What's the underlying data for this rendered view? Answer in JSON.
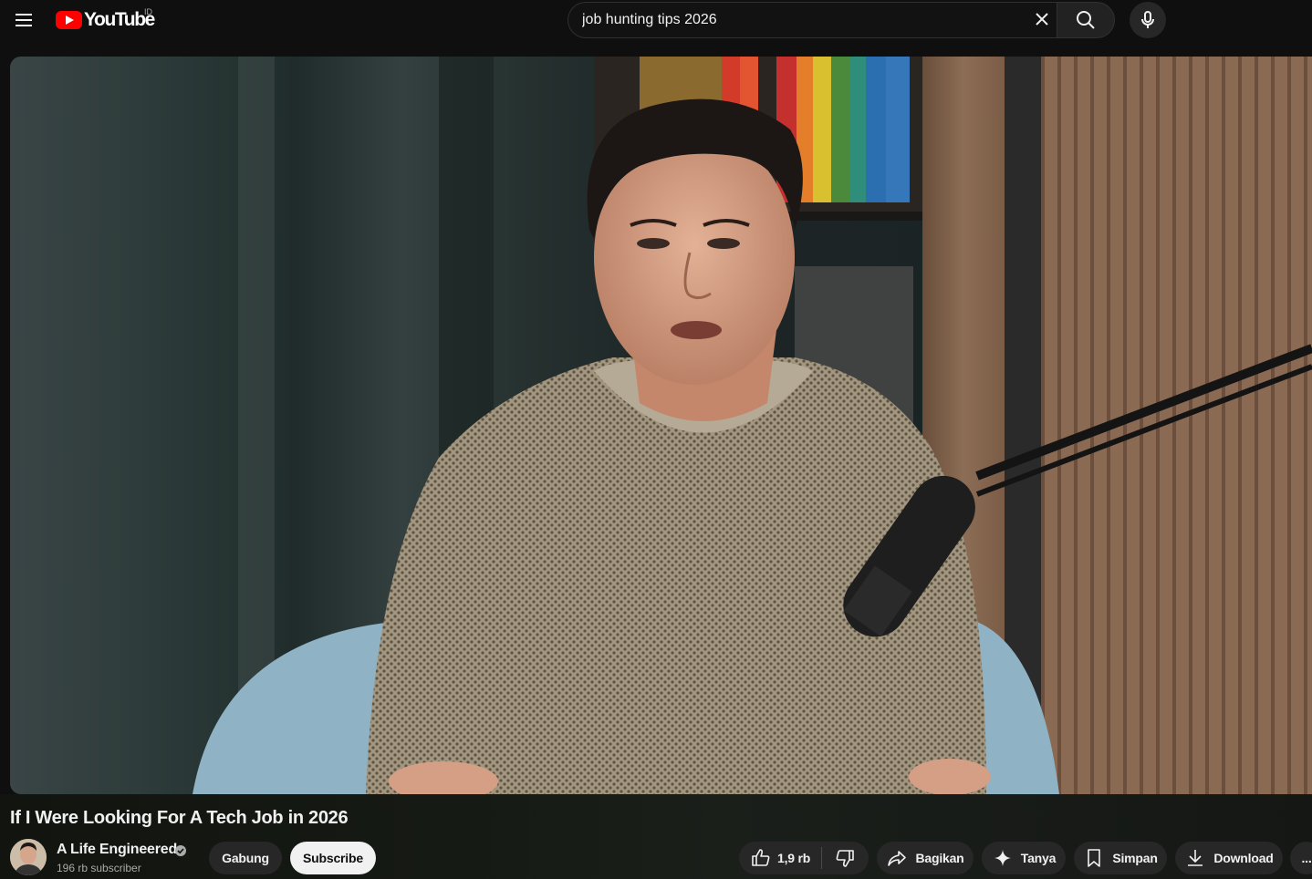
{
  "header": {
    "logo_text": "YouTube",
    "country_code": "ID",
    "search_value": "job hunting tips 2026",
    "icons": [
      "hamburger-menu-icon",
      "youtube-logo",
      "close-icon",
      "search-icon",
      "microphone-icon"
    ]
  },
  "video": {
    "title": "If I Were Looking For A Tech Job in 2026",
    "thumbnail_desc_colors": {
      "background": "#2a3636",
      "sweater": "#9c907e",
      "chair": "#8fb2c4"
    }
  },
  "channel": {
    "name": "A Life Engineered",
    "subscribers": "196 rb subscriber",
    "join_label": "Gabung",
    "subscribe_label": "Subscribe"
  },
  "actions": {
    "like_count": "1,9 rb",
    "share_label": "Bagikan",
    "ask_label": "Tanya",
    "save_label": "Simpan",
    "download_label": "Download",
    "more_label": "..."
  },
  "colors": {
    "brand_red": "#ff0000",
    "background": "#0f0f0f",
    "pill": "#272727",
    "subscribe_bg": "#f1f1f1"
  }
}
